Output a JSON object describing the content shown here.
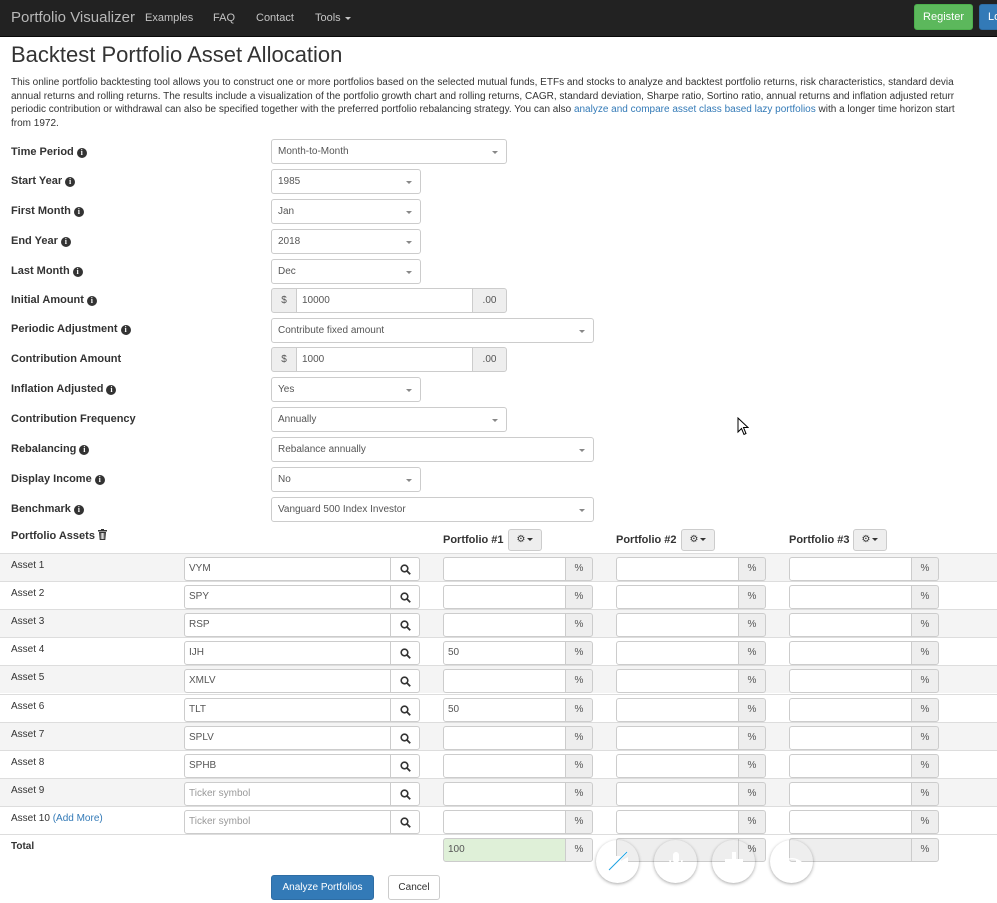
{
  "navbar": {
    "brand": "Portfolio Visualizer",
    "links": [
      "Examples",
      "FAQ",
      "Contact",
      "Tools"
    ],
    "register_label": "Register",
    "login_label": "Lo"
  },
  "page_title": "Backtest Portfolio Asset Allocation",
  "intro": {
    "line1": "This online portfolio backtesting tool allows you to construct one or more portfolios based on the selected mutual funds, ETFs and stocks to analyze and backtest portfolio returns, risk characteristics, standard devia",
    "line2": "annual returns and rolling returns. The results include a visualization of the portfolio growth chart and rolling returns, CAGR, standard deviation, Sharpe ratio, Sortino ratio, annual returns and inflation adjusted returr",
    "line3_a": "periodic contribution or withdrawal can also be specified together with the preferred portfolio rebalancing strategy. You can also ",
    "line3_link": "analyze and compare asset class based lazy portfolios",
    "line3_b": " with a longer time horizon start",
    "line4": "from 1972."
  },
  "form": {
    "time_period": {
      "label": "Time Period",
      "value": "Month-to-Month"
    },
    "start_year": {
      "label": "Start Year",
      "value": "1985"
    },
    "first_month": {
      "label": "First Month",
      "value": "Jan"
    },
    "end_year": {
      "label": "End Year",
      "value": "2018"
    },
    "last_month": {
      "label": "Last Month",
      "value": "Dec"
    },
    "initial_amount": {
      "label": "Initial Amount",
      "prefix": "$",
      "value": "10000",
      "suffix": ".00"
    },
    "periodic_adjustment": {
      "label": "Periodic Adjustment",
      "value": "Contribute fixed amount"
    },
    "contribution_amount": {
      "label": "Contribution Amount",
      "prefix": "$",
      "value": "1000",
      "suffix": ".00"
    },
    "inflation_adjusted": {
      "label": "Inflation Adjusted",
      "value": "Yes"
    },
    "contribution_frequency": {
      "label": "Contribution Frequency",
      "value": "Annually"
    },
    "rebalancing": {
      "label": "Rebalancing",
      "value": "Rebalance annually"
    },
    "display_income": {
      "label": "Display Income",
      "value": "No"
    },
    "benchmark": {
      "label": "Benchmark",
      "value": "Vanguard 500 Index Investor"
    }
  },
  "assets": {
    "section_label": "Portfolio Assets",
    "portfolio_headers": [
      "Portfolio #1",
      "Portfolio #2",
      "Portfolio #3"
    ],
    "pct_symbol": "%",
    "ticker_placeholder": "Ticker symbol",
    "rows": [
      {
        "label": "Asset 1",
        "ticker": "VYM",
        "p1": "",
        "p2": "",
        "p3": ""
      },
      {
        "label": "Asset 2",
        "ticker": "SPY",
        "p1": "",
        "p2": "",
        "p3": ""
      },
      {
        "label": "Asset 3",
        "ticker": "RSP",
        "p1": "",
        "p2": "",
        "p3": ""
      },
      {
        "label": "Asset 4",
        "ticker": "IJH",
        "p1": "50",
        "p2": "",
        "p3": ""
      },
      {
        "label": "Asset 5",
        "ticker": "XMLV",
        "p1": "",
        "p2": "",
        "p3": ""
      },
      {
        "label": "Asset 6",
        "ticker": "TLT",
        "p1": "50",
        "p2": "",
        "p3": ""
      },
      {
        "label": "Asset 7",
        "ticker": "SPLV",
        "p1": "",
        "p2": "",
        "p3": ""
      },
      {
        "label": "Asset 8",
        "ticker": "SPHB",
        "p1": "",
        "p2": "",
        "p3": ""
      },
      {
        "label": "Asset 9",
        "ticker": "",
        "p1": "",
        "p2": "",
        "p3": ""
      },
      {
        "label": "Asset 10",
        "ticker": "",
        "p1": "",
        "p2": "",
        "p3": "",
        "add_more": "(Add More)"
      }
    ],
    "total": {
      "label": "Total",
      "p1": "100",
      "p2": "",
      "p3": ""
    }
  },
  "actions": {
    "analyze_label": "Analyze Portfolios",
    "cancel_label": "Cancel"
  },
  "call_controls": [
    {
      "icon": "video-off-icon",
      "color": "#1ba1e2"
    },
    {
      "icon": "microphone-icon",
      "color": "#1ba1e2"
    },
    {
      "icon": "plus-icon",
      "color": "#1ba1e2"
    },
    {
      "icon": "hang-up-icon",
      "color": "#e81123"
    }
  ],
  "colors": {
    "navbar_bg": "#222222",
    "primary": "#337ab7",
    "success": "#5cb85c",
    "total_ok_bg": "#dff0d8"
  }
}
